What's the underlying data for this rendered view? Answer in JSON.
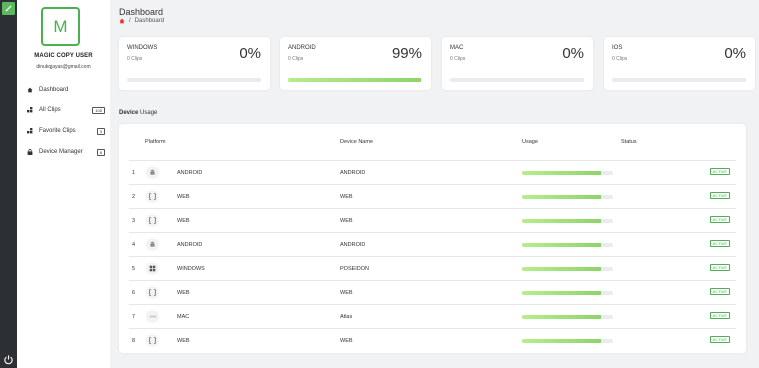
{
  "app": {
    "top_icon": "pencil-icon",
    "power_icon": "power-icon"
  },
  "sidebar": {
    "avatar_initial": "M",
    "user_name": "MAGIC COPY USER",
    "user_email": "dinukqjayas@gmail.com",
    "items": [
      {
        "label": "Dashboard",
        "icon": "home-icon",
        "count": ""
      },
      {
        "label": "All Clips",
        "icon": "clips-icon",
        "count": "105"
      },
      {
        "label": "Favorite Clips",
        "icon": "favorite-icon",
        "count": "3"
      },
      {
        "label": "Device Manager",
        "icon": "lock-icon",
        "count": "8"
      }
    ]
  },
  "header": {
    "title": "Dashboard",
    "breadcrumb_sep": "/",
    "breadcrumb_current": "Dashboard"
  },
  "cards": [
    {
      "name": "WINDOWS",
      "clips": "0 Clips",
      "percent": "0%",
      "progress": 0
    },
    {
      "name": "ANDROID",
      "clips": "0 Clips",
      "percent": "99%",
      "progress": 0.99
    },
    {
      "name": "MAC",
      "clips": "0 Clips",
      "percent": "0%",
      "progress": 0
    },
    {
      "name": "IOS",
      "clips": "0 Clips",
      "percent": "0%",
      "progress": 0
    }
  ],
  "section": {
    "title_bold": "Device",
    "title_rest": " Usage"
  },
  "table": {
    "columns": {
      "platform": "Platform",
      "device": "Device Name",
      "usage": "Usage",
      "status": "Status"
    },
    "rows": [
      {
        "num": "1",
        "icon": "android-icon",
        "platform": "ANDROID",
        "device": "ANDROID",
        "usage": 0.87,
        "status": "ACTIVE"
      },
      {
        "num": "2",
        "icon": "web-icon",
        "platform": "WEB",
        "device": "WEB",
        "usage": 0.87,
        "status": "ACTIVE"
      },
      {
        "num": "3",
        "icon": "web-icon",
        "platform": "WEB",
        "device": "WEB",
        "usage": 0.87,
        "status": "ACTIVE"
      },
      {
        "num": "4",
        "icon": "android-icon",
        "platform": "ANDROID",
        "device": "ANDROID",
        "usage": 0.87,
        "status": "ACTIVE"
      },
      {
        "num": "5",
        "icon": "windows-icon",
        "platform": "WINDOWS",
        "device": "POSEIDON",
        "usage": 0.87,
        "status": "ACTIVE"
      },
      {
        "num": "6",
        "icon": "web-icon",
        "platform": "WEB",
        "device": "WEB",
        "usage": 0.87,
        "status": "ACTIVE"
      },
      {
        "num": "7",
        "icon": "mac-icon",
        "platform": "MAC",
        "device": "Atlas",
        "usage": 0.87,
        "status": "ACTIVE"
      },
      {
        "num": "8",
        "icon": "web-icon",
        "platform": "WEB",
        "device": "WEB",
        "usage": 0.87,
        "status": "ACTIVE"
      }
    ]
  },
  "colors": {
    "accent": "#4caf50",
    "bar_fill": "#9fe07a",
    "rail": "#2c2f33"
  }
}
